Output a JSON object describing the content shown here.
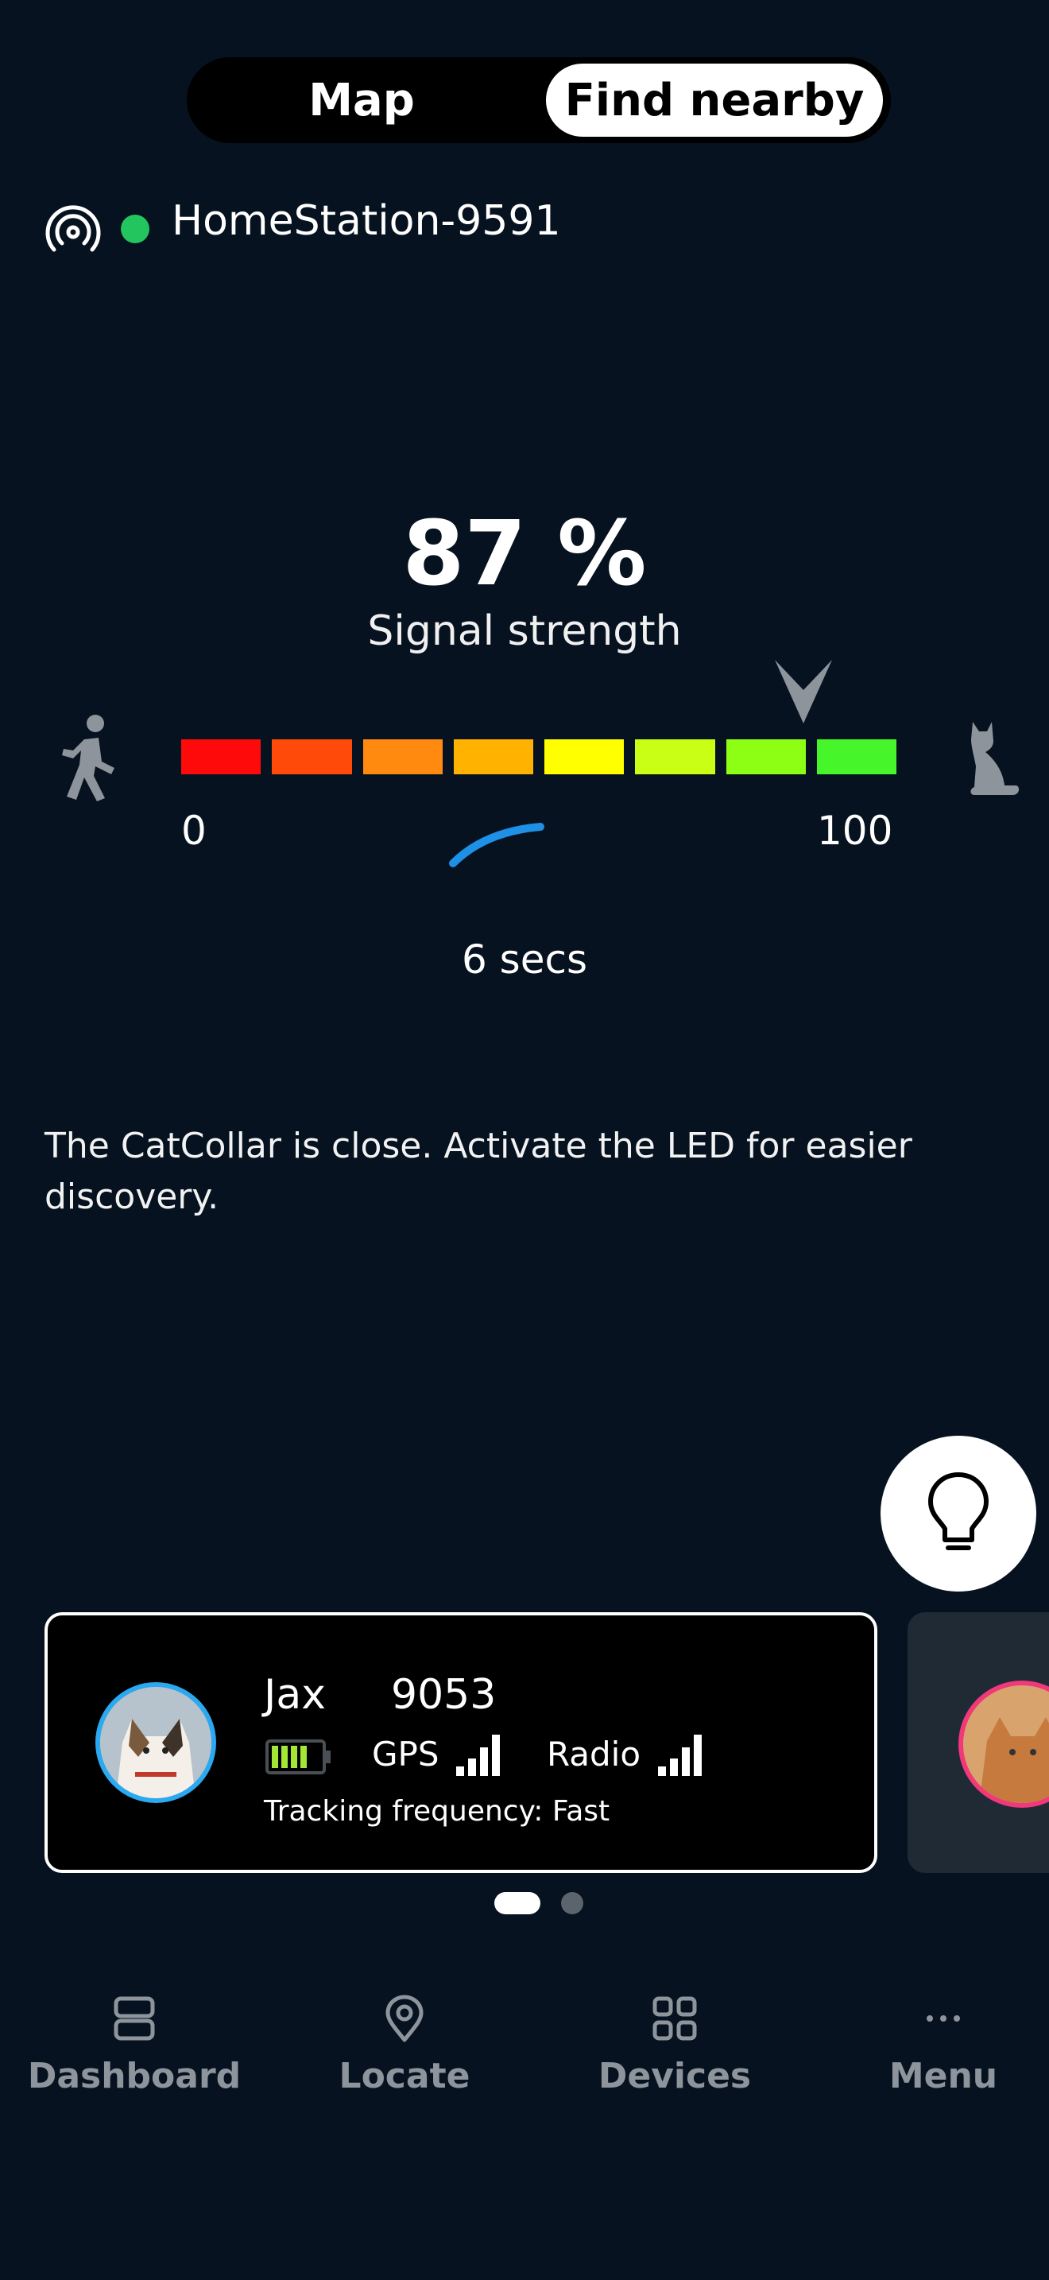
{
  "segmented": {
    "map_label": "Map",
    "find_nearby_label": "Find nearby",
    "selected": "Find nearby"
  },
  "station": {
    "name": "HomeStation-9591",
    "status_color": "#22c55e",
    "icon": "radio-signal-icon"
  },
  "signal": {
    "value_text": "87 %",
    "label": "Signal strength",
    "percent": 87,
    "scale_min": "0",
    "scale_max": "100",
    "segment_colors": [
      "#ff0a0a",
      "#ff4a0a",
      "#ff8a0f",
      "#ffb300",
      "#ffff00",
      "#c8ff14",
      "#8cff14",
      "#46f52a"
    ],
    "timer": "6 secs"
  },
  "hint": "The CatCollar is close. Activate the LED for easier discovery.",
  "led_button_icon": "lightbulb-icon",
  "pets": [
    {
      "name": "Jax",
      "id": "9053",
      "gps_label": "GPS",
      "radio_label": "Radio",
      "tracking": "Tracking frequency: Fast",
      "ring_color": "#2aa8f0",
      "battery_color": "#a3e635"
    },
    {
      "ring_color": "#f0387a"
    }
  ],
  "pager": {
    "count": 2,
    "active": 0
  },
  "nav": [
    {
      "label": "Dashboard",
      "icon": "dashboard-icon"
    },
    {
      "label": "Locate",
      "icon": "location-pin-icon"
    },
    {
      "label": "Devices",
      "icon": "grid-icon"
    },
    {
      "label": "Menu",
      "icon": "more-dots-icon"
    }
  ]
}
